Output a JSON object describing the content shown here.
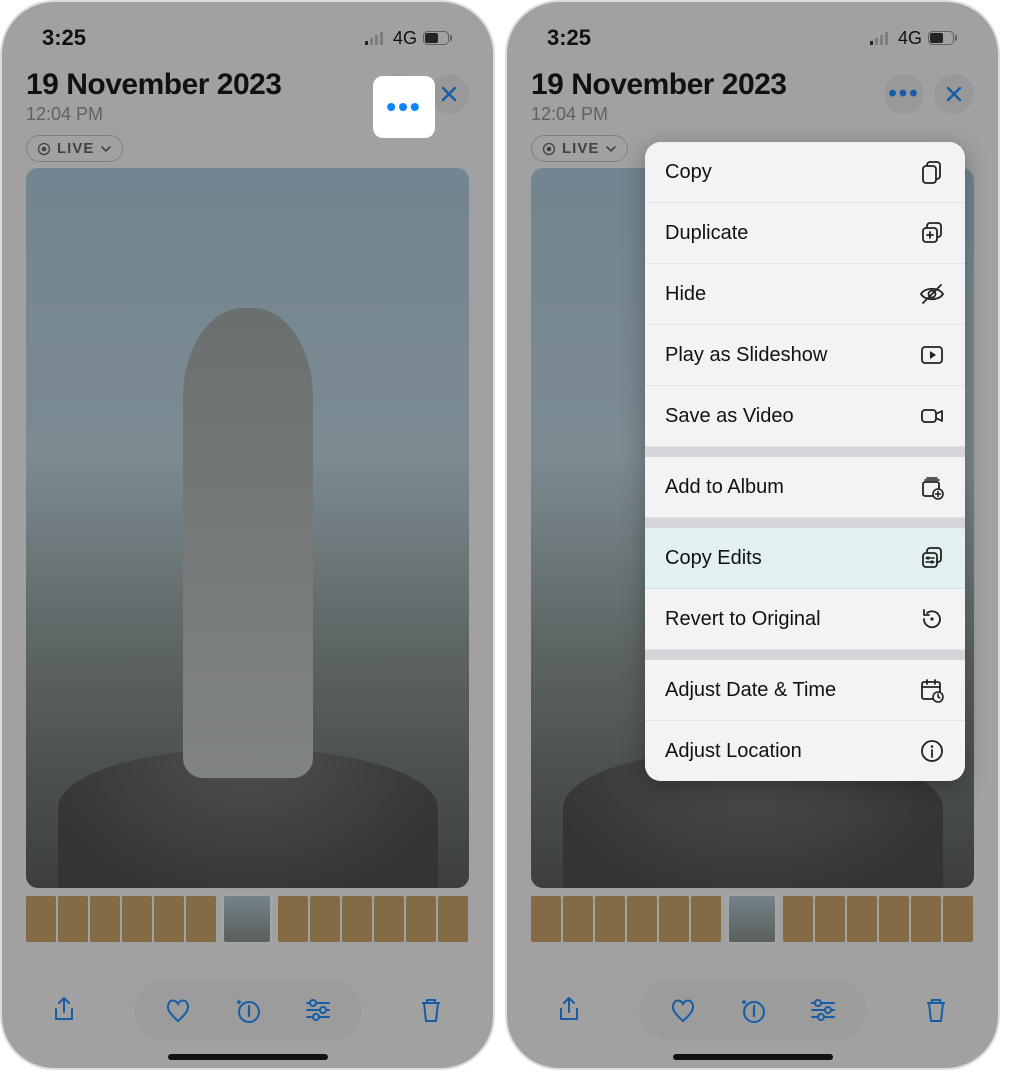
{
  "status": {
    "time": "3:25",
    "network": "4G"
  },
  "header": {
    "date": "19 November 2023",
    "time": "12:04 PM"
  },
  "live_badge": "LIVE",
  "menu": {
    "copy": "Copy",
    "duplicate": "Duplicate",
    "hide": "Hide",
    "slideshow": "Play as Slideshow",
    "save_video": "Save as Video",
    "add_album": "Add to Album",
    "copy_edits": "Copy Edits",
    "revert": "Revert to Original",
    "adjust_date": "Adjust Date & Time",
    "adjust_location": "Adjust Location"
  }
}
